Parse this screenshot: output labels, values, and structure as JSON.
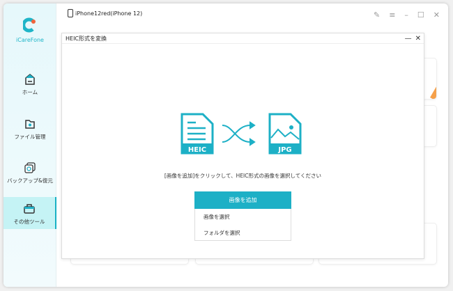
{
  "app": {
    "name": "iCareFone",
    "accent": "#1db0c6"
  },
  "device": {
    "label": "iPhone12red(iPhone 12)"
  },
  "sidebar": {
    "items": [
      {
        "label": "ホーム"
      },
      {
        "label": "ファイル管理"
      },
      {
        "label": "バックアップ&復元"
      },
      {
        "label": "その他ツール",
        "active": true
      }
    ]
  },
  "dialog": {
    "title": "HEIC形式を変換",
    "from_label": "HEIC",
    "to_label": "JPG",
    "hint": "[画像を追加]をクリックして、HEIC形式の画像を選択してください",
    "add_button": "画像を追加",
    "menu": [
      {
        "label": "画像を選択"
      },
      {
        "label": "フォルダを選択"
      }
    ]
  }
}
